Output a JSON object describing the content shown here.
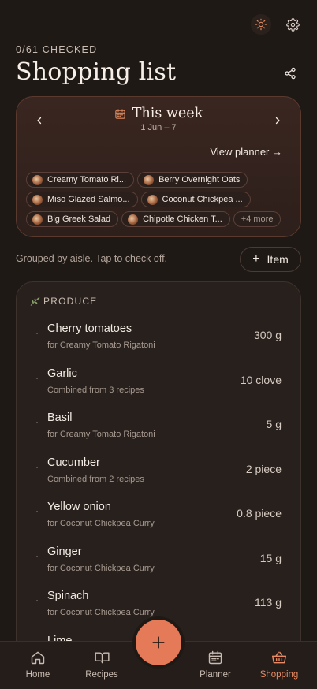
{
  "header": {
    "checked_count": "0/61 CHECKED",
    "title": "Shopping list"
  },
  "week": {
    "title": "This week",
    "range": "1 Jun – 7",
    "view_planner": "View planner →",
    "recipes": [
      "Creamy Tomato Ri...",
      "Berry Overnight Oats",
      "Miso Glazed Salmo...",
      "Coconut Chickpea ...",
      "Big Greek Salad",
      "Chipotle Chicken T..."
    ],
    "more": "+4 more"
  },
  "controls": {
    "hint": "Grouped by aisle. Tap to check off.",
    "add_item": "Item"
  },
  "aisle": {
    "name": "PRODUCE",
    "items": [
      {
        "name": "Cherry tomatoes",
        "note": "for Creamy Tomato Rigatoni",
        "qty": "300 g"
      },
      {
        "name": "Garlic",
        "note": "Combined from 3 recipes",
        "qty": "10 clove"
      },
      {
        "name": "Basil",
        "note": "for Creamy Tomato Rigatoni",
        "qty": "5 g"
      },
      {
        "name": "Cucumber",
        "note": "Combined from 2 recipes",
        "qty": "2 piece"
      },
      {
        "name": "Yellow onion",
        "note": "for Coconut Chickpea Curry",
        "qty": "0.8 piece"
      },
      {
        "name": "Ginger",
        "note": "for Coconut Chickpea Curry",
        "qty": "15 g"
      },
      {
        "name": "Spinach",
        "note": "for Coconut Chickpea Curry",
        "qty": "113 g"
      },
      {
        "name": "Lime",
        "note": "",
        "qty": ""
      }
    ]
  },
  "tabs": {
    "home": "Home",
    "recipes": "Recipes",
    "planner": "Planner",
    "shopping": "Shopping"
  },
  "colors": {
    "background": "#1f1916",
    "accent": "#e57a58",
    "active_tab": "#e88a63"
  }
}
